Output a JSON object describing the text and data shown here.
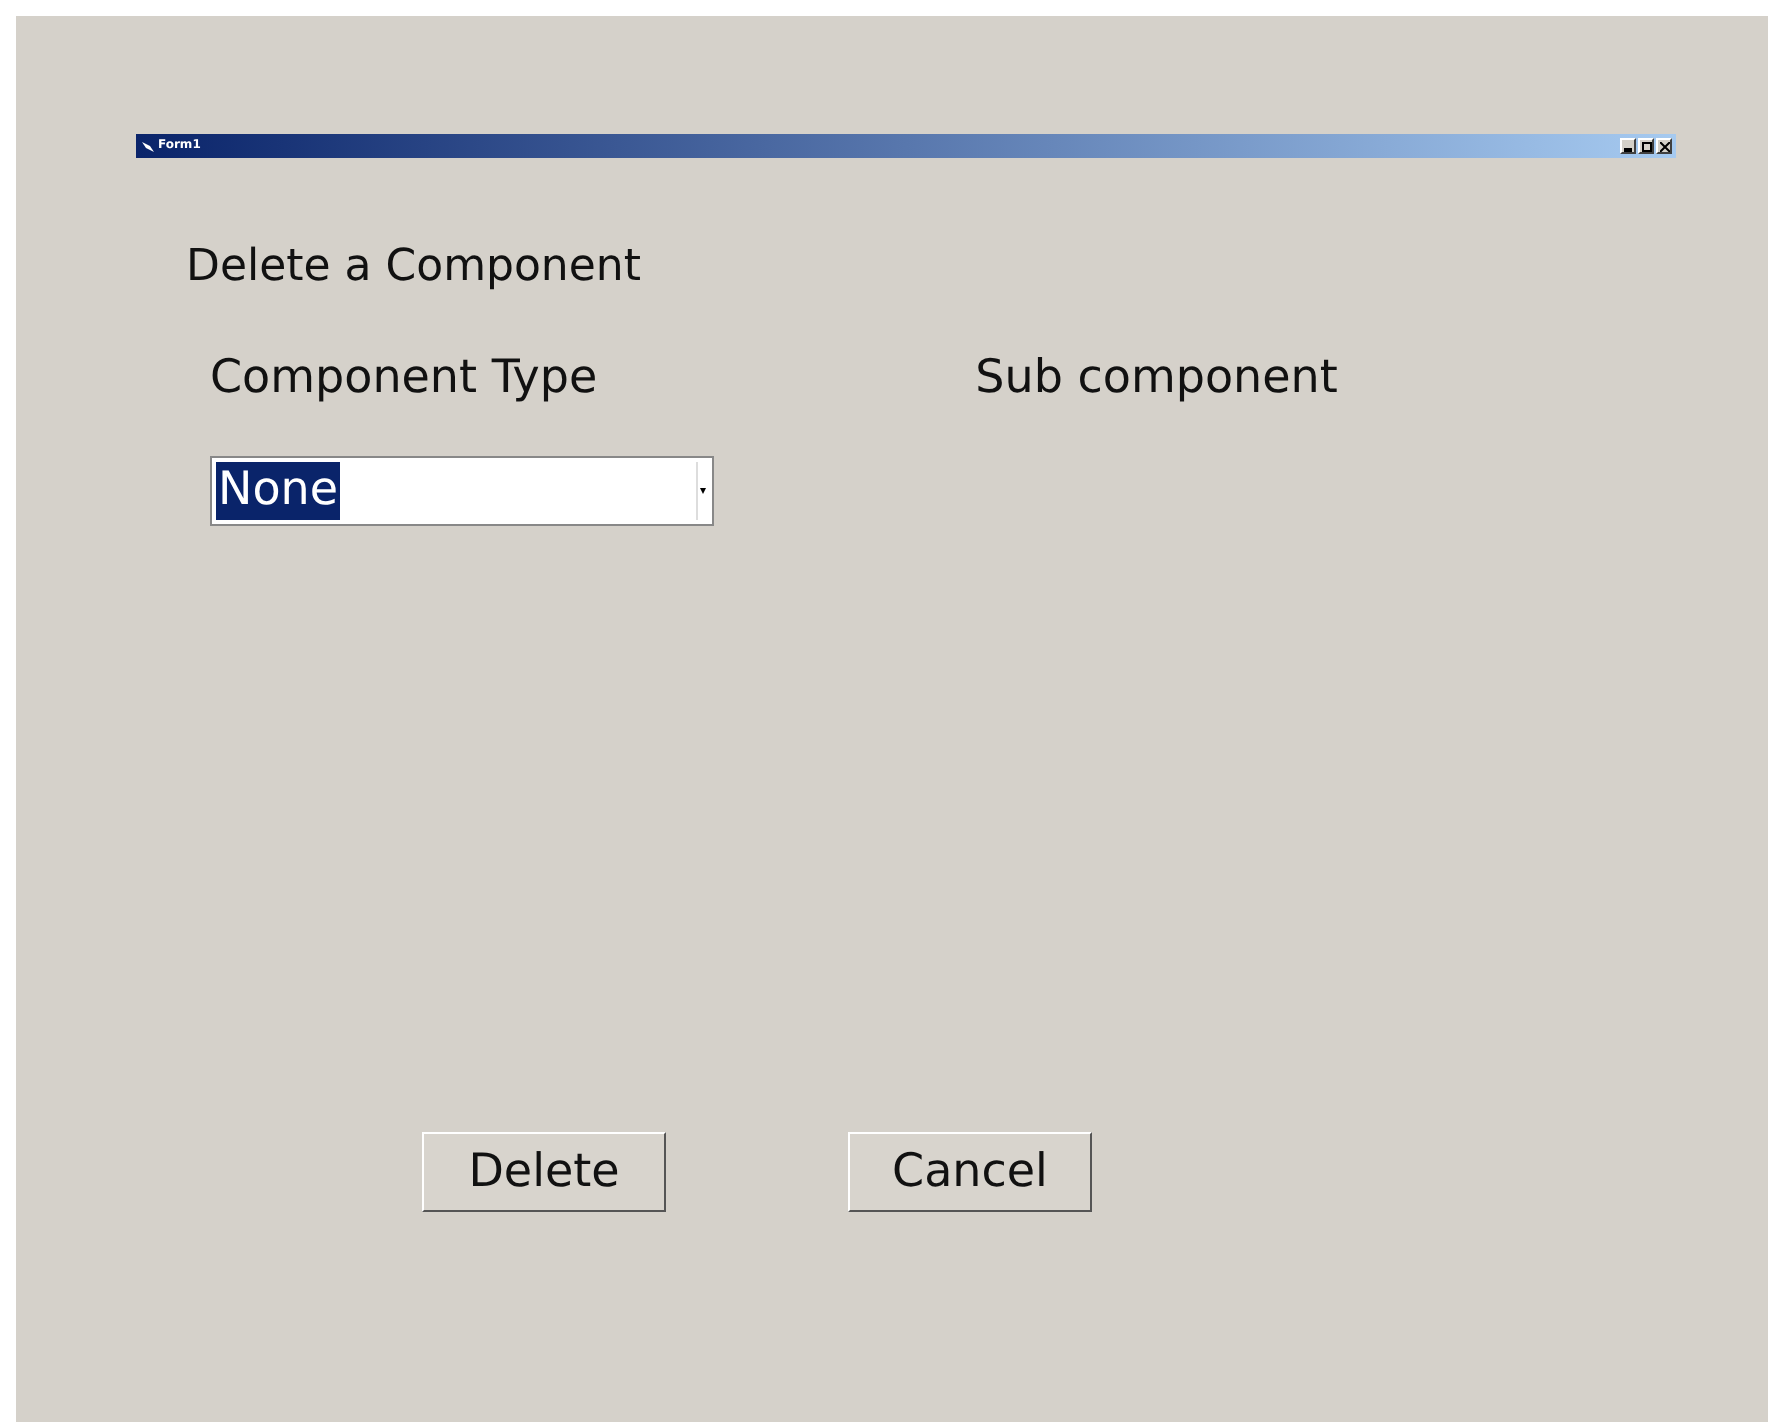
{
  "window": {
    "title": "Form1"
  },
  "heading": "Delete a Component",
  "labels": [
    "Component Type",
    "Sub component"
  ],
  "component_type_dropdown": {
    "value": "None",
    "text_highlighted": true
  },
  "buttons": [
    "Delete",
    "Cancel"
  ]
}
